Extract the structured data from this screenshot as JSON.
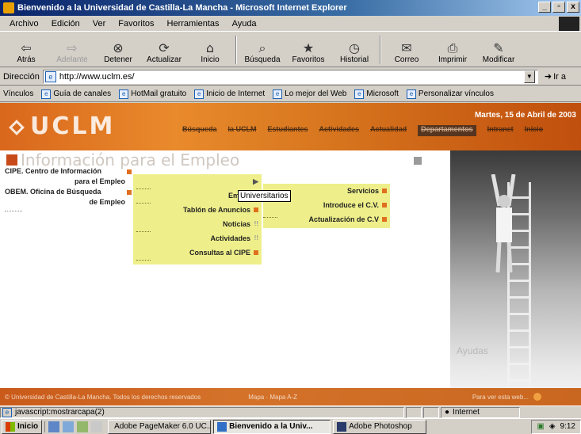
{
  "window": {
    "title": "Bienvenido a la Universidad de Castilla-La Mancha - Microsoft Internet Explorer",
    "buttons": [
      "_",
      "▫",
      "x"
    ]
  },
  "menubar": {
    "items": [
      "Archivo",
      "Edición",
      "Ver",
      "Favoritos",
      "Herramientas",
      "Ayuda"
    ]
  },
  "toolbar": {
    "buttons": [
      {
        "label": "Atrás",
        "icon": "back-arrow-icon",
        "glyph": "⇦",
        "enabled": true
      },
      {
        "label": "Adelante",
        "icon": "forward-arrow-icon",
        "glyph": "⇨",
        "enabled": false
      },
      {
        "label": "Detener",
        "icon": "stop-icon",
        "glyph": "⊗",
        "enabled": true
      },
      {
        "label": "Actualizar",
        "icon": "refresh-icon",
        "glyph": "⟳",
        "enabled": true
      },
      {
        "label": "Inicio",
        "icon": "home-icon",
        "glyph": "⌂",
        "enabled": true
      },
      {
        "label": "Búsqueda",
        "icon": "search-icon",
        "glyph": "⌕",
        "enabled": true
      },
      {
        "label": "Favoritos",
        "icon": "favorites-icon",
        "glyph": "★",
        "enabled": true
      },
      {
        "label": "Historial",
        "icon": "history-icon",
        "glyph": "◷",
        "enabled": true
      },
      {
        "label": "Correo",
        "icon": "mail-icon",
        "glyph": "✉",
        "enabled": true
      },
      {
        "label": "Imprimir",
        "icon": "print-icon",
        "glyph": "⎙",
        "enabled": true
      },
      {
        "label": "Modificar",
        "icon": "edit-icon",
        "glyph": "✎",
        "enabled": true
      }
    ]
  },
  "addressbar": {
    "label": "Dirección",
    "url": "http://www.uclm.es/",
    "go_label": "Ir a"
  },
  "linksbar": {
    "label": "Vínculos",
    "items": [
      "Guía de canales",
      "HotMail gratuito",
      "Inicio de Internet",
      "Lo mejor del Web",
      "Microsoft",
      "Personalizar vínculos"
    ]
  },
  "page": {
    "logo": "UCLM",
    "date": "Martes, 15 de Abril de 2003",
    "nav": [
      "Búsqueda",
      "la UCLM",
      "Estudiantes",
      "Actividades",
      "Actualidad",
      "Departamentos",
      "Intranet",
      "Inicio"
    ],
    "section_title": "Información para el Empleo",
    "side_links": [
      {
        "line1": "CIPE. Centro de Información",
        "line2": "para el Empleo"
      },
      {
        "line1": "OBEM. Oficina de Búsqueda",
        "line2": "de Empleo"
      }
    ],
    "menu1": [
      {
        "label": "",
        "marker": "arrow"
      },
      {
        "label": "Empre",
        "marker": "none"
      },
      {
        "label": "Tablón de Anuncios",
        "marker": "square"
      },
      {
        "label": "Noticias",
        "marker": "dim"
      },
      {
        "label": "Actividades",
        "marker": "dim"
      },
      {
        "label": "Consultas al CIPE",
        "marker": "square"
      }
    ],
    "menu2": [
      {
        "label": "Servicios",
        "marker": "square"
      },
      {
        "label": "Introduce el C.V.",
        "marker": "square"
      },
      {
        "label": "Actualización de C.V",
        "marker": "square"
      }
    ],
    "tooltip": "Universitarios",
    "photo_caption": "Ayudas",
    "footer_left": "© Universidad de Castilla-La Mancha. Todos los derechos reservados",
    "footer_mid": "Mapa · Mapa A-Z",
    "footer_right": "Para ver esta web..."
  },
  "statusbar": {
    "text": "javascript:mostrarcapa(2)",
    "zone": "Internet"
  },
  "taskbar": {
    "start": "Inicio",
    "tasks": [
      {
        "label": "Adobe PageMaker 6.0 UC...",
        "active": false
      },
      {
        "label": "Bienvenido a la Univ...",
        "active": true
      },
      {
        "label": "Adobe Photoshop",
        "active": false
      }
    ],
    "clock": "9:12"
  },
  "colors": {
    "banner_orange": "#d9671c",
    "menu_yellow": "#eeef8a",
    "marker_orange": "#e07020",
    "title_blue": "#0a246a"
  }
}
